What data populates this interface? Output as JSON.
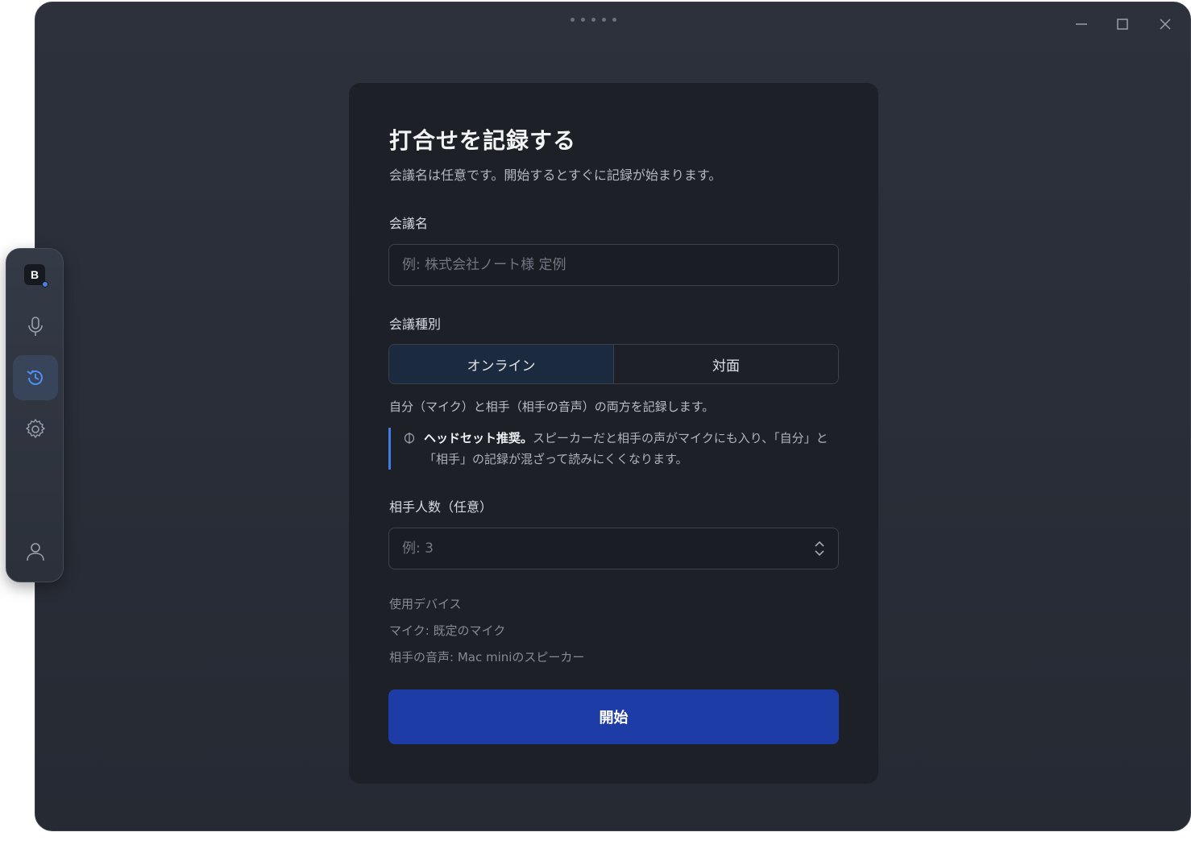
{
  "window": {
    "drag_handle_dots": 5
  },
  "sidebar": {
    "logo_letter": "B",
    "items": [
      {
        "icon": "microphone-icon",
        "active": false
      },
      {
        "icon": "history-icon",
        "active": true
      },
      {
        "icon": "gear-icon",
        "active": false
      },
      {
        "icon": "user-icon",
        "active": false
      }
    ]
  },
  "form": {
    "title": "打合せを記録する",
    "subtitle": "会議名は任意です。開始するとすぐに記録が始まります。",
    "meeting_name": {
      "label": "会議名",
      "placeholder": "例: 株式会社ノート様 定例",
      "value": ""
    },
    "meeting_type": {
      "label": "会議種別",
      "options": [
        "オンライン",
        "対面"
      ],
      "selected": "オンライン"
    },
    "hint": "自分（マイク）と相手（相手の音声）の両方を記録します。",
    "note": {
      "strong": "ヘッドセット推奨。",
      "text": "スピーカーだと相手の声がマイクにも入り、「自分」と「相手」の記録が混ざって読みにくくなります。"
    },
    "participants": {
      "label": "相手人数（任意）",
      "placeholder": "例: 3",
      "value": ""
    },
    "devices": {
      "heading": "使用デバイス",
      "mic": "マイク: 既定のマイク",
      "speaker": "相手の音声: Mac miniのスピーカー"
    },
    "start_label": "開始"
  },
  "colors": {
    "accent": "#3f7ce8",
    "button": "#1e3ca5",
    "card": "#1d2026"
  }
}
